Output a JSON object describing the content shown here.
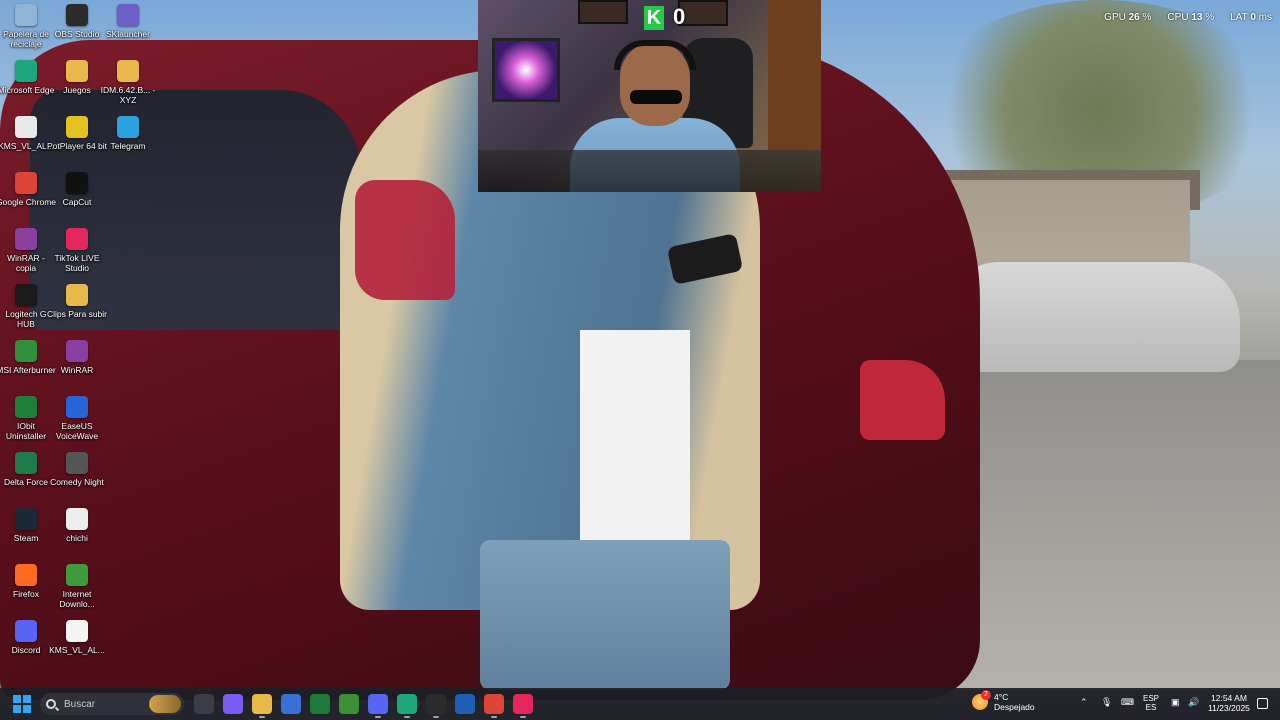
{
  "desktop": {
    "icons": [
      {
        "label": "Papelera de reciclaje",
        "icon": "recycle-bin-icon",
        "color": "#8fb4d6"
      },
      {
        "label": "OBS Studio",
        "icon": "obs-studio-icon",
        "color": "#2b2b2b"
      },
      {
        "label": "SKlauncher",
        "icon": "sklauncher-icon",
        "color": "#6d5fc8"
      },
      {
        "label": "Microsoft Edge",
        "icon": "edge-icon",
        "color": "#1fa67a"
      },
      {
        "label": "Juegos",
        "icon": "folder-icon",
        "color": "#e8b84a"
      },
      {
        "label": "IDM.6.42.B... - XYZ",
        "icon": "folder-icon",
        "color": "#e8b84a"
      },
      {
        "label": "KMS_VL_AL...",
        "icon": "file-icon",
        "color": "#e9e9e9"
      },
      {
        "label": "PotPlayer 64 bit",
        "icon": "potplayer-icon",
        "color": "#e3c21f"
      },
      {
        "label": "Telegram",
        "icon": "telegram-icon",
        "color": "#2aa3e0"
      },
      {
        "label": "Google Chrome",
        "icon": "chrome-icon",
        "color": "#db4437"
      },
      {
        "label": "CapCut",
        "icon": "capcut-icon",
        "color": "#111111"
      },
      {
        "label": "WinRAR - copia",
        "icon": "winrar-icon",
        "color": "#8a3fa0"
      },
      {
        "label": "TikTok LIVE Studio",
        "icon": "tiktok-live-icon",
        "color": "#e3265b"
      },
      {
        "label": "Logitech G HUB",
        "icon": "logitech-icon",
        "color": "#1a1a1a"
      },
      {
        "label": "Clips Para subir",
        "icon": "folder-icon",
        "color": "#e8b84a"
      },
      {
        "label": "MSI Afterburner",
        "icon": "msi-afterburner-icon",
        "color": "#2f8f3a"
      },
      {
        "label": "WinRAR",
        "icon": "winrar-icon",
        "color": "#8a3fa0"
      },
      {
        "label": "IObit Uninstaller",
        "icon": "iobit-icon",
        "color": "#1e7f3a"
      },
      {
        "label": "EaseUS VoiceWave",
        "icon": "easeus-icon",
        "color": "#2864d8"
      },
      {
        "label": "Delta Force",
        "icon": "delta-force-icon",
        "color": "#1f7a4c"
      },
      {
        "label": "Comedy Night",
        "icon": "comedy-night-icon",
        "color": "#555555"
      },
      {
        "label": "Steam",
        "icon": "steam-icon",
        "color": "#1b2838"
      },
      {
        "label": "chichi",
        "icon": "video-file-icon",
        "color": "#eeeeee"
      },
      {
        "label": "Firefox",
        "icon": "firefox-icon",
        "color": "#ff6a22"
      },
      {
        "label": "Internet Downlo...",
        "icon": "idm-icon",
        "color": "#3e9b3a"
      },
      {
        "label": "Discord",
        "icon": "discord-icon",
        "color": "#5865f2"
      },
      {
        "label": "KMS_VL_AL...",
        "icon": "text-file-icon",
        "color": "#f4f4f4"
      }
    ]
  },
  "webcam": {
    "kill_letter": "K",
    "kill_count": "0"
  },
  "perf_overlay": {
    "gpu_label": "GPU",
    "gpu_value": "26",
    "cpu_label": "CPU",
    "cpu_value": "13",
    "lat_label": "LAT",
    "lat_value": "0"
  },
  "taskbar": {
    "search_placeholder": "Buscar",
    "apps": [
      {
        "icon": "task-view-icon",
        "color": "#3a3d48"
      },
      {
        "icon": "copilot-icon",
        "color": "#7a5cf0"
      },
      {
        "icon": "file-explorer-icon",
        "color": "#e8b84a"
      },
      {
        "icon": "microsoft-store-icon",
        "color": "#3a6fd8"
      },
      {
        "icon": "upwork-icon",
        "color": "#1d7a3a"
      },
      {
        "icon": "vectorworks-icon",
        "color": "#3c8f34"
      },
      {
        "icon": "discord-icon",
        "color": "#5865f2"
      },
      {
        "icon": "edge-icon",
        "color": "#1fa67a"
      },
      {
        "icon": "obs-studio-icon",
        "color": "#2b2b2b"
      },
      {
        "icon": "outlook-icon",
        "color": "#1e5fb5"
      },
      {
        "icon": "chrome-icon",
        "color": "#db4437"
      },
      {
        "icon": "tiktok-icon",
        "color": "#e3265b"
      }
    ],
    "weather": {
      "badge": "2",
      "temp": "4°C",
      "condition": "Despejado"
    },
    "language": {
      "lang": "ESP",
      "layout": "ES"
    },
    "clock": {
      "time": "12:54 AM",
      "date": "11/23/2025"
    }
  }
}
